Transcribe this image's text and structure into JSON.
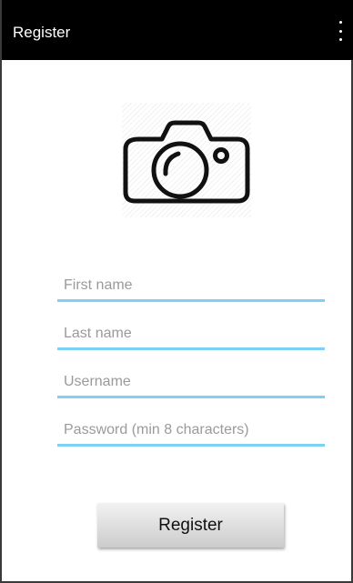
{
  "appbar": {
    "title": "Register",
    "menu_icon": "more-vert-icon",
    "background": "#000000"
  },
  "photo": {
    "icon": "camera-icon"
  },
  "form": {
    "first_name": {
      "placeholder": "First name",
      "value": ""
    },
    "last_name": {
      "placeholder": "Last name",
      "value": ""
    },
    "username": {
      "placeholder": "Username",
      "value": ""
    },
    "password": {
      "placeholder": "Password (min 8 characters)",
      "value": ""
    },
    "underline_color": "#7fd0f5"
  },
  "actions": {
    "register_label": "Register"
  }
}
